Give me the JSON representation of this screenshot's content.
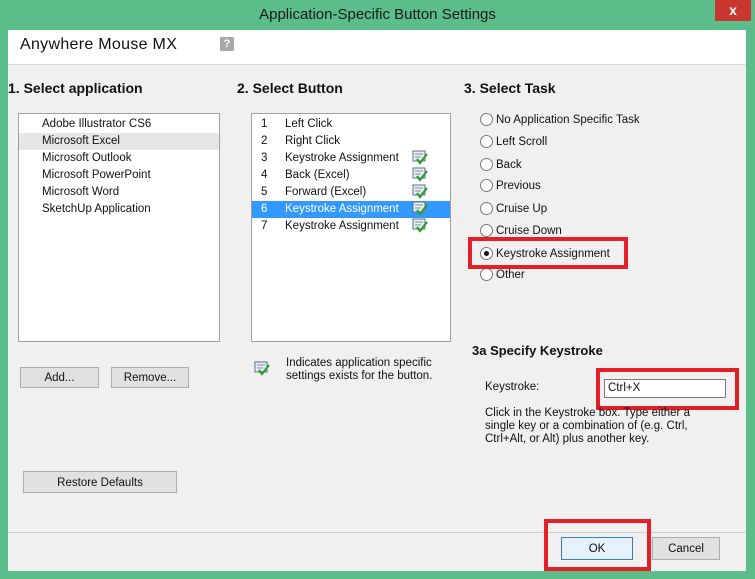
{
  "window": {
    "title": "Application-Specific Button Settings",
    "close_glyph": "x"
  },
  "header": {
    "app_name": "Anywhere Mouse MX",
    "help_glyph": "?"
  },
  "section1": {
    "title": "1.  Select application",
    "applications": [
      "Adobe Illustrator CS6",
      "Microsoft Excel",
      "Microsoft Outlook",
      "Microsoft PowerPoint",
      "Microsoft Word",
      "SketchUp Application"
    ],
    "selected_index": 1,
    "add_label": "Add...",
    "remove_label": "Remove...",
    "restore_label": "Restore Defaults"
  },
  "section2": {
    "title": "2.  Select Button",
    "buttons": [
      {
        "num": "1",
        "label": "Left Click",
        "specific": false
      },
      {
        "num": "2",
        "label": "Right Click",
        "specific": false
      },
      {
        "num": "3",
        "label": "Keystroke Assignment",
        "specific": true
      },
      {
        "num": "4",
        "label": "Back (Excel)",
        "specific": true
      },
      {
        "num": "5",
        "label": "Forward (Excel)",
        "specific": true
      },
      {
        "num": "6",
        "label": "Keystroke Assignment",
        "specific": true
      },
      {
        "num": "7",
        "label": "Keystroke Assignment",
        "specific": true
      }
    ],
    "selected_index": 5,
    "legend_line1": "Indicates application specific",
    "legend_line2": "settings exists for the button."
  },
  "section3": {
    "title": "3.  Select Task",
    "tasks": [
      "No Application Specific Task",
      "Left Scroll",
      "Back",
      "Previous",
      "Cruise Up",
      "Cruise Down",
      "Keystroke Assignment",
      "Other"
    ],
    "selected_index": 6
  },
  "section3a": {
    "title": "3a  Specify Keystroke",
    "keystroke_label": "Keystroke:",
    "keystroke_value": "Ctrl+X",
    "help_line1": "Click in the Keystroke box. Type either a",
    "help_line2": "single key or a combination of (e.g. Ctrl,",
    "help_line3": "Ctrl+Alt, or Alt) plus another key."
  },
  "footer": {
    "ok_label": "OK",
    "cancel_label": "Cancel"
  },
  "colors": {
    "highlight_red": "#e32027",
    "selection_blue": "#3399ff",
    "frame_green": "#5bbd8a"
  }
}
